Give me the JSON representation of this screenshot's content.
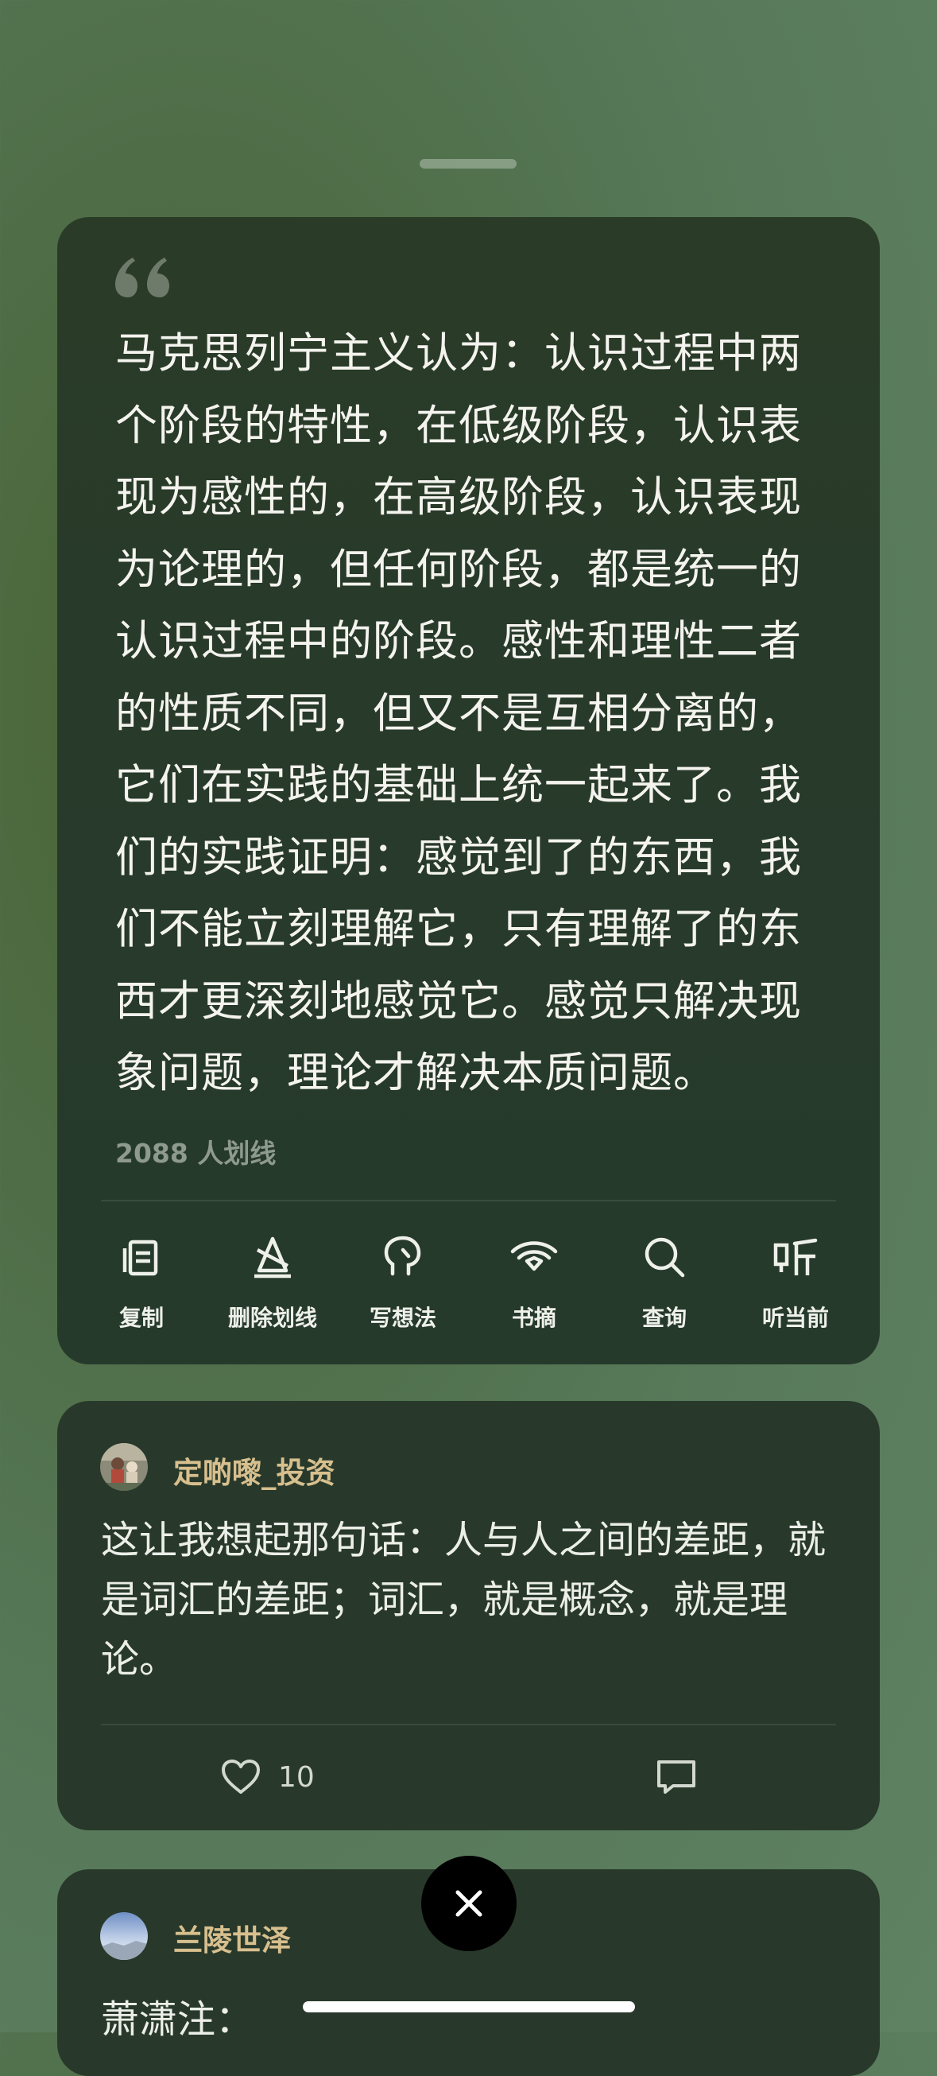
{
  "quote": {
    "text": "马克思列宁主义认为：认识过程中两个阶段的特性，在低级阶段，认识表现为感性的，在高级阶段，认识表现为论理的，但任何阶段，都是统一的认识过程中的阶段。感性和理性二者的性质不同，但又不是互相分离的，它们在实践的基础上统一起来了。我们的实践证明：感觉到了的东西，我们不能立刻理解它，只有理解了的东西才更深刻地感觉它。感觉只解决现象问题，理论才解决本质问题。",
    "highlight_count": "2088 人划线"
  },
  "actions": [
    {
      "label": "复制",
      "icon": "copy-icon"
    },
    {
      "label": "删除划线",
      "icon": "remove-highlight-icon"
    },
    {
      "label": "写想法",
      "icon": "write-thought-icon"
    },
    {
      "label": "书摘",
      "icon": "excerpt-icon"
    },
    {
      "label": "查询",
      "icon": "search-icon"
    },
    {
      "label": "听当前",
      "icon": "listen-icon"
    }
  ],
  "comments": [
    {
      "username": "定啲嚟_投资",
      "text": "这让我想起那句话：人与人之间的差距，就是词汇的差距；词汇，就是概念，就是理论。",
      "likes": "10"
    },
    {
      "username": "兰陵世泽",
      "text": "萧潇注："
    }
  ],
  "colors": {
    "username": "#d7bf8e",
    "card": "#28392b",
    "background": "#587a5a"
  }
}
